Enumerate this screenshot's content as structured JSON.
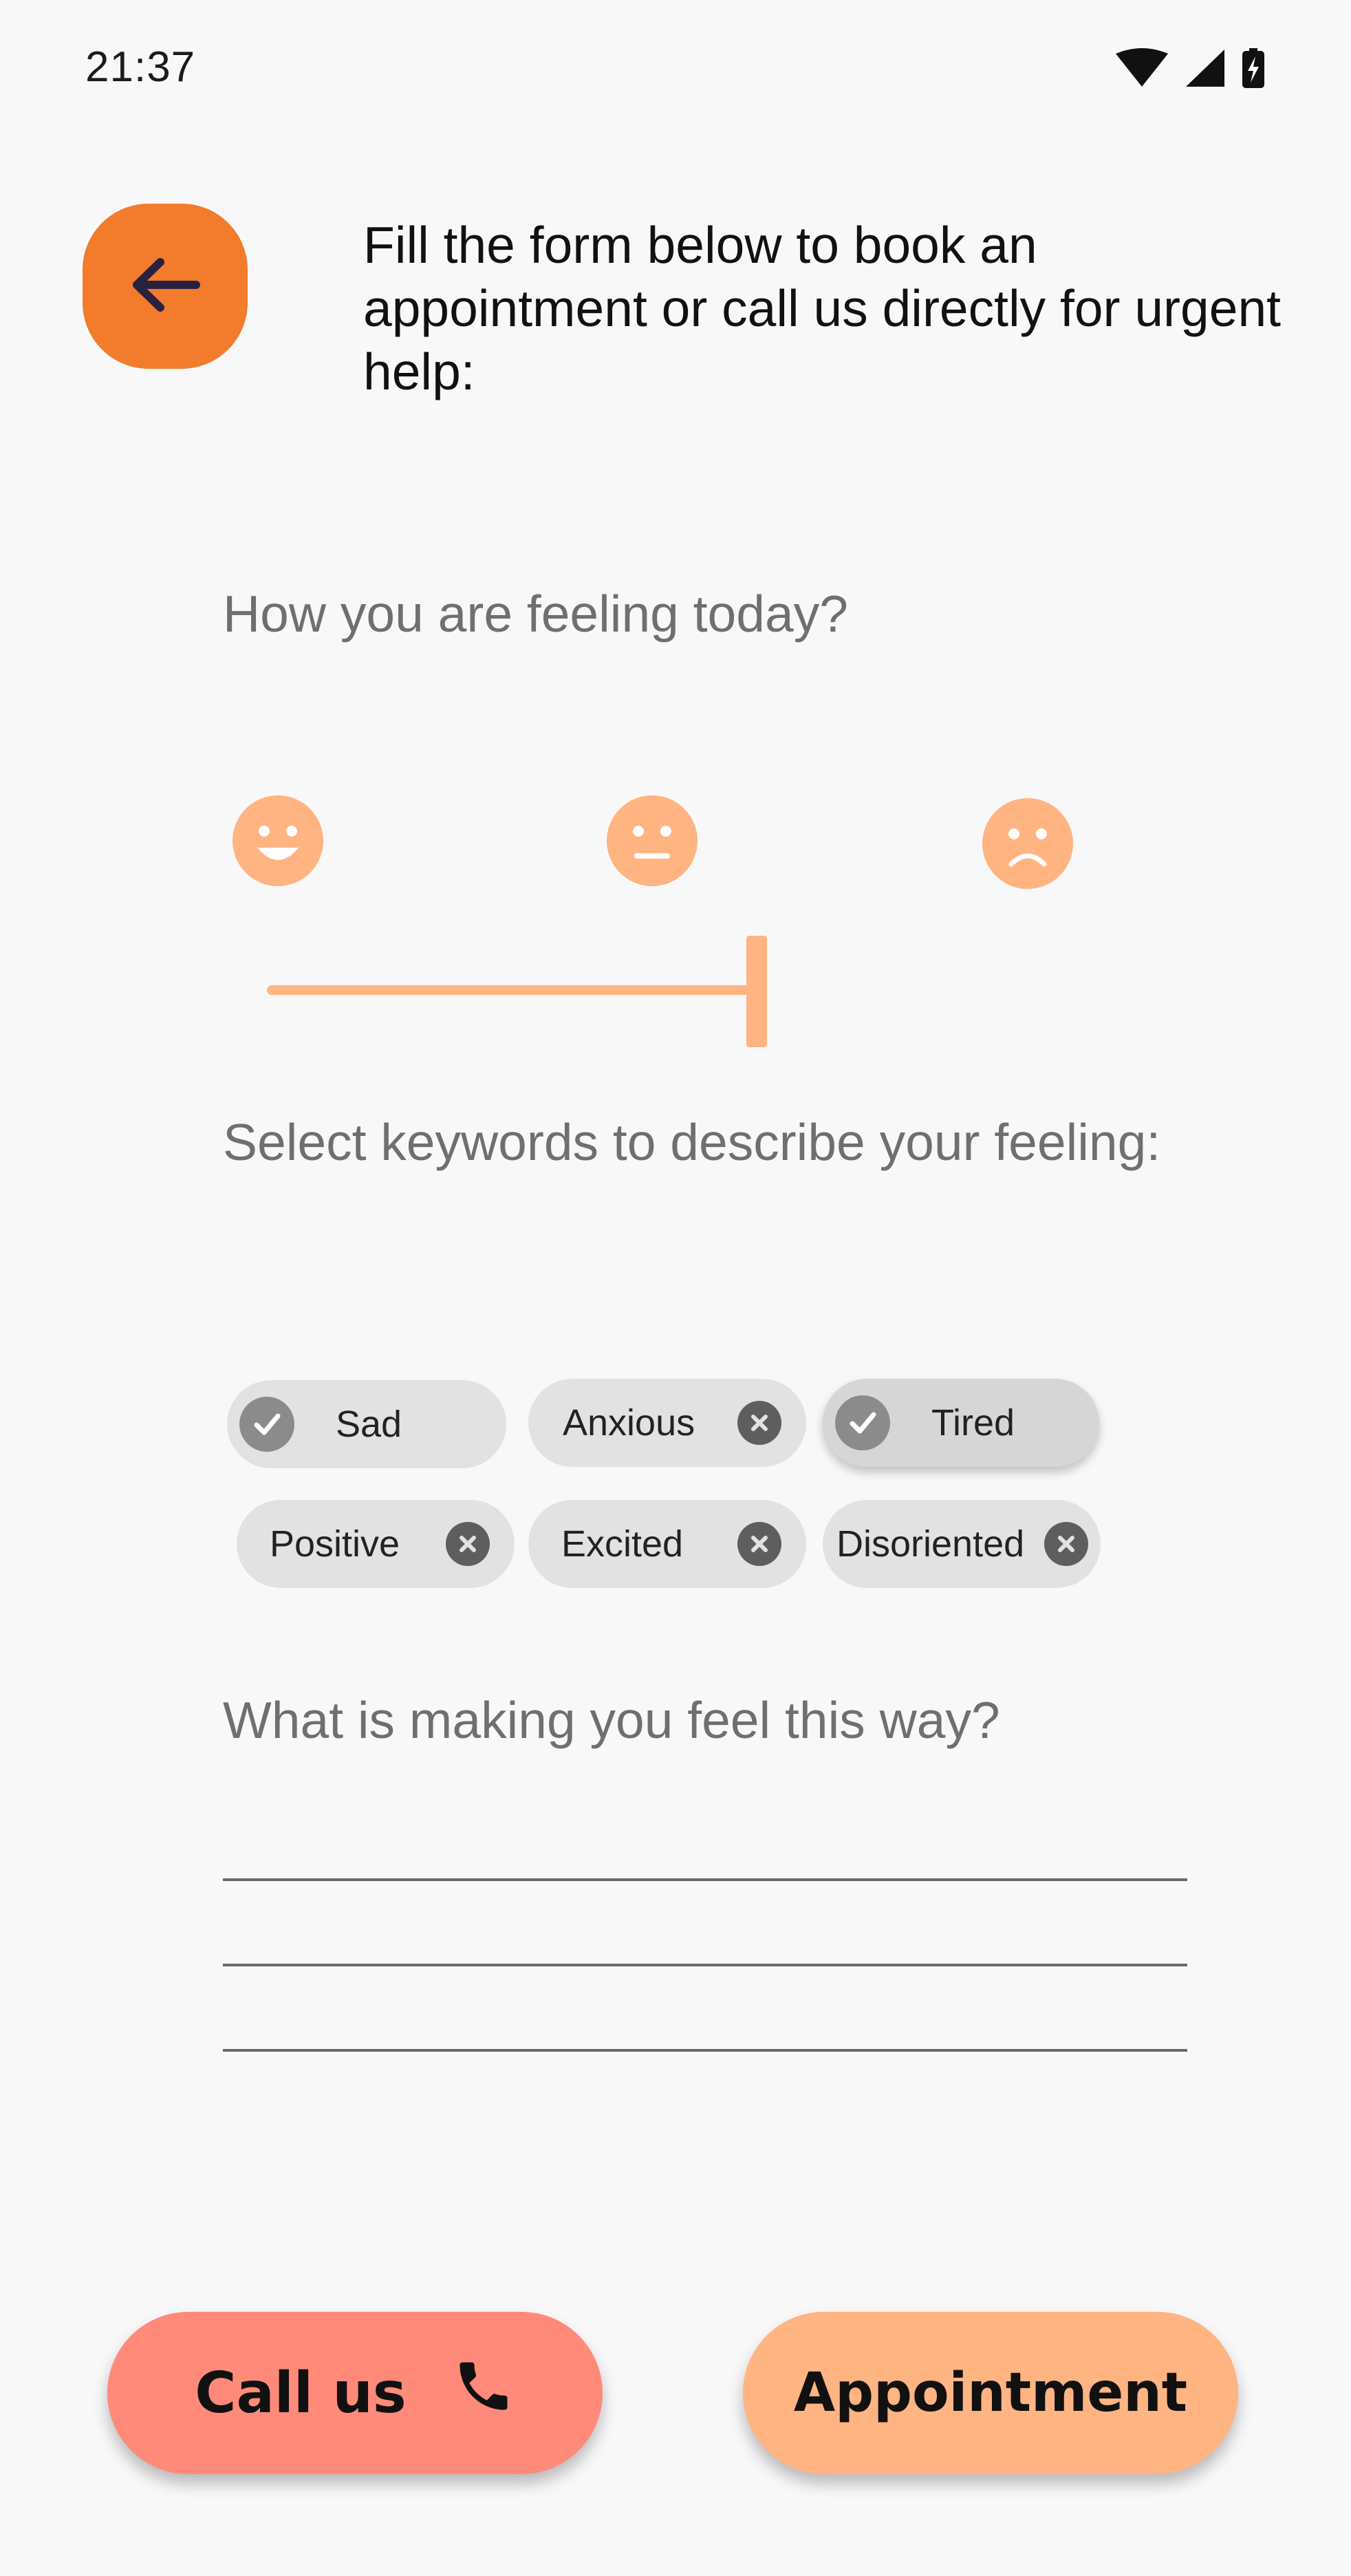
{
  "status_bar": {
    "time": "21:37",
    "icons": [
      "wifi-icon",
      "signal-icon",
      "battery-charging-icon"
    ]
  },
  "header": {
    "back_icon": "arrow-left-icon",
    "text": "Fill the form below to book an appointment or call us directly for urgent help:"
  },
  "mood": {
    "question": "How you are feeling today?",
    "faces": [
      "happy-face-icon",
      "neutral-face-icon",
      "sad-face-icon"
    ],
    "slider_value": 0.5
  },
  "keywords": {
    "question": "Select keywords to describe your feeling:",
    "chips": [
      {
        "label": "Sad",
        "selected": true
      },
      {
        "label": "Anxious",
        "selected": false
      },
      {
        "label": "Tired",
        "selected": true
      },
      {
        "label": "Positive",
        "selected": false
      },
      {
        "label": "Excited",
        "selected": false
      },
      {
        "label": "Disoriented",
        "selected": false
      }
    ]
  },
  "reason": {
    "question": "What is making you feel this way?",
    "value": ""
  },
  "actions": {
    "call_label": "Call us",
    "call_icon": "phone-icon",
    "appointment_label": "Appointment"
  },
  "colors": {
    "accent": "#f27b2c",
    "peach": "#ffb482",
    "coral": "#ff8a7a",
    "background": "#f8f8f8"
  }
}
